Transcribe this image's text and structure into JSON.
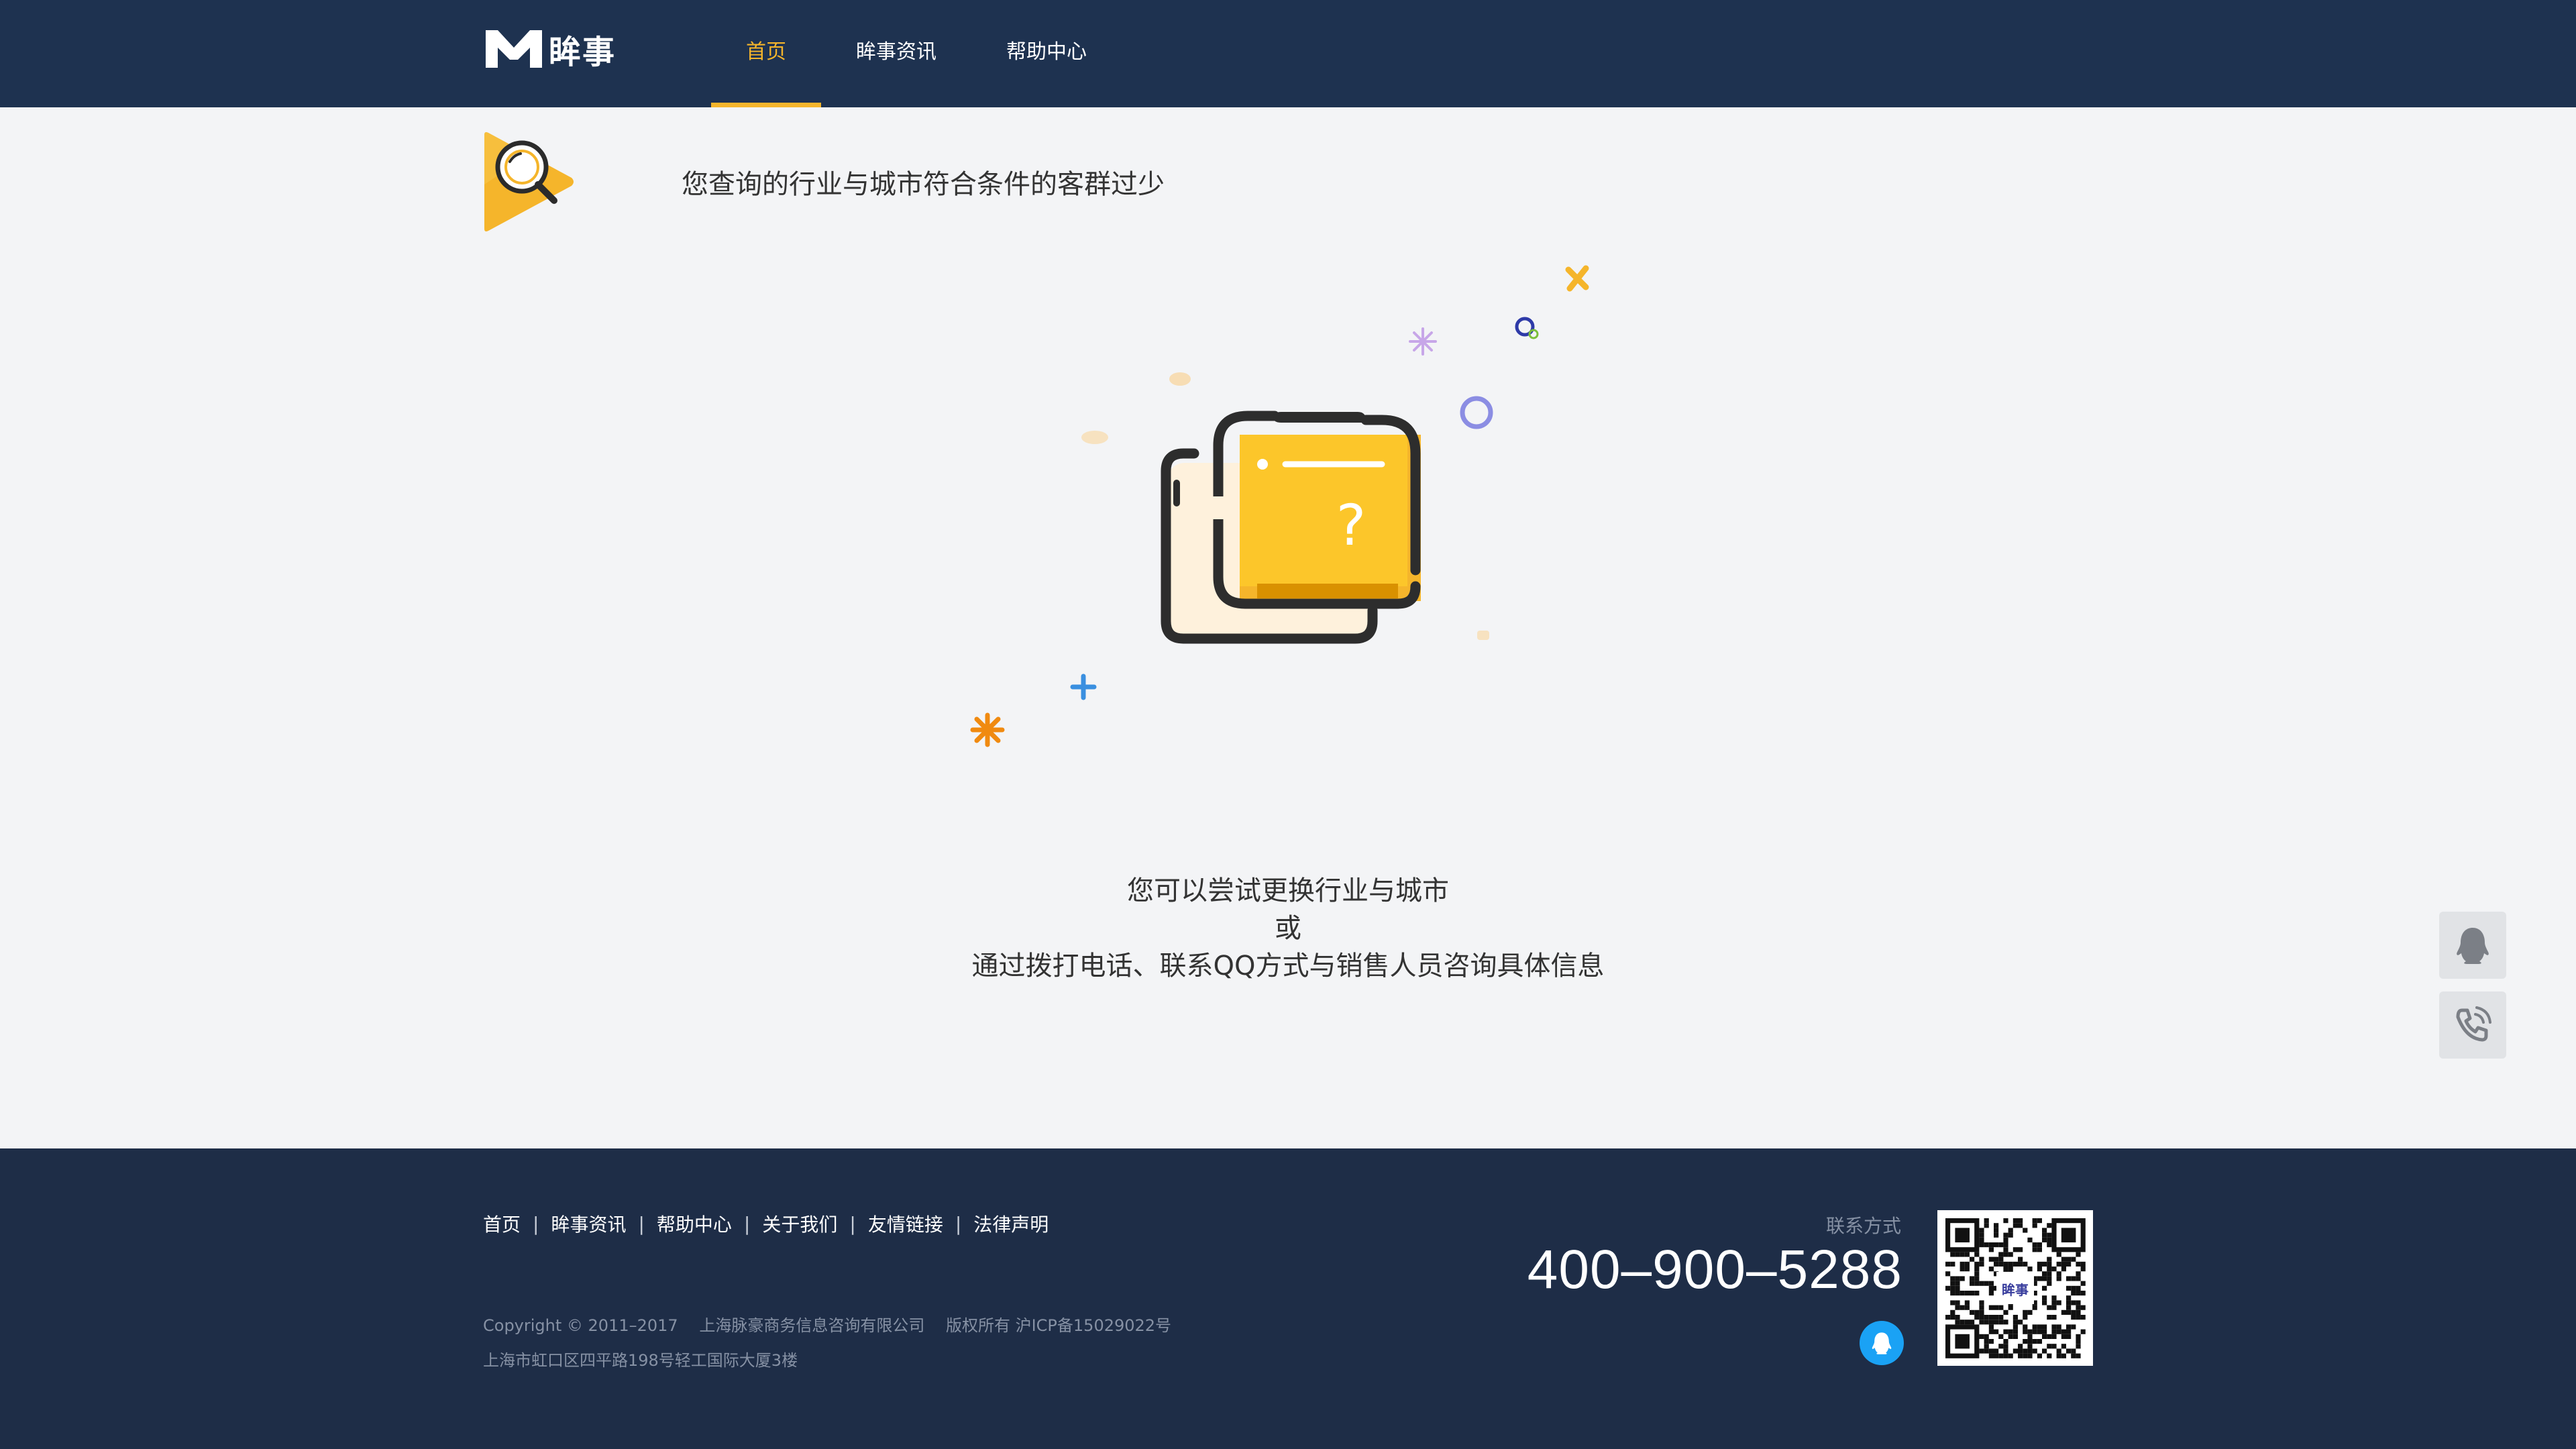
{
  "brand": {
    "name": "眸事",
    "accent_color": "#f5b52b",
    "header_bg": "#1e3250",
    "footer_bg": "#1e2d47"
  },
  "nav": {
    "items": [
      {
        "label": "首页",
        "active": true
      },
      {
        "label": "眸事资讯",
        "active": false
      },
      {
        "label": "帮助中心",
        "active": false
      }
    ]
  },
  "notice": {
    "icon": "search-play-icon",
    "text": "您查询的行业与城市符合条件的客群过少"
  },
  "illustration": {
    "icon": "unknown-folder-icon",
    "symbol": "?"
  },
  "suggestion": {
    "line1": "您可以尝试更换行业与城市",
    "line2": "或",
    "line3": "通过拨打电话、联系QQ方式与销售人员咨询具体信息"
  },
  "side_buttons": [
    {
      "icon": "qq-icon"
    },
    {
      "icon": "phone-icon"
    }
  ],
  "footer": {
    "links": [
      "首页",
      "眸事资讯",
      "帮助中心",
      "关于我们",
      "友情链接",
      "法律声明"
    ],
    "separator": "|",
    "copyright": "Copyright © 2011–2017",
    "company": "上海脉豪商务信息咨询有限公司",
    "rights": "版权所有 沪ICP备15029022号",
    "address": "上海市虹口区四平路198号轻工国际大厦3楼",
    "contact_label": "联系方式",
    "phone": "400–900–5288",
    "qq_icon": "qq-icon",
    "qr_logo_text": "眸事"
  }
}
